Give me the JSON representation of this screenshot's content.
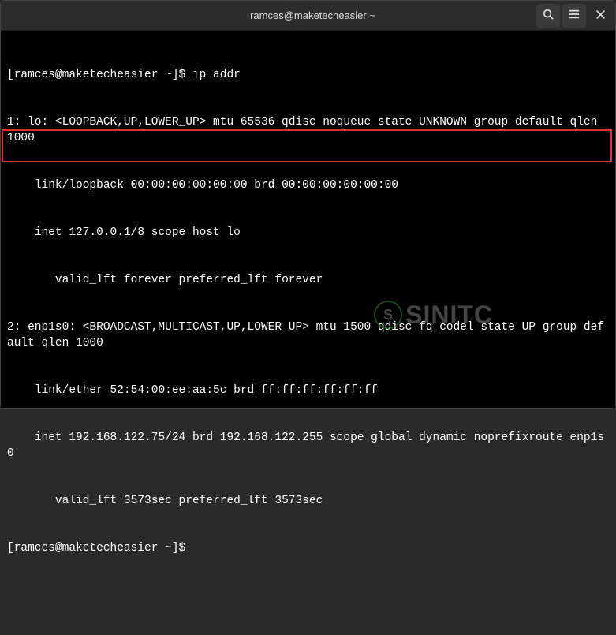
{
  "titlebar": {
    "title": "ramces@maketecheasier:~"
  },
  "terminal": {
    "prompt1": "[ramces@maketecheasier ~]$ ",
    "command1": "ip addr",
    "line1": "1: lo: <LOOPBACK,UP,LOWER_UP> mtu 65536 qdisc noqueue state UNKNOWN group default qlen 1000",
    "line2": "    link/loopback 00:00:00:00:00:00 brd 00:00:00:00:00:00",
    "line3": "    inet 127.0.0.1/8 scope host lo",
    "line4": "       valid_lft forever preferred_lft forever",
    "line5": "2: enp1s0: <BROADCAST,MULTICAST,UP,LOWER_UP> mtu 1500 qdisc fq_codel state UP group default qlen 1000",
    "line6": "    link/ether 52:54:00:ee:aa:5c brd ff:ff:ff:ff:ff:ff",
    "line7": "    inet 192.168.122.75/24 brd 192.168.122.255 scope global dynamic noprefixroute enp1s0",
    "line8": "       valid_lft 3573sec preferred_lft 3573sec",
    "prompt2": "[ramces@maketecheasier ~]$ "
  },
  "watermark": {
    "inner": "S",
    "text": "SINITC"
  }
}
